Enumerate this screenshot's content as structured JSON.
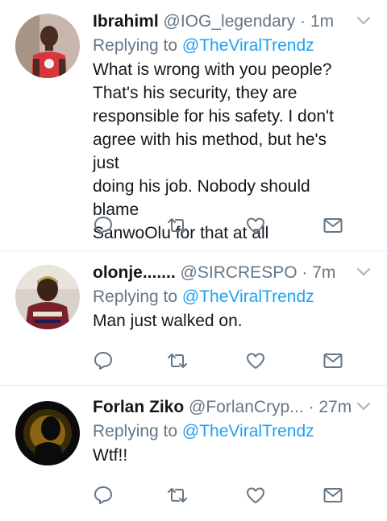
{
  "colors": {
    "link": "#1da1f2",
    "secondary_text": "#657786",
    "primary_text": "#14171a",
    "divider": "#e1e8ed"
  },
  "tweets": [
    {
      "name": "Ibrahiml",
      "handle": "@IOG_legendary",
      "separator": "·",
      "time": "1m",
      "replying_prefix": "Replying to",
      "replying_to": "@TheViralTrendz",
      "text_lines": [
        "What is wrong with you people?",
        "That's his security, they are",
        "responsible for his safety. I don't",
        "agree with his method, but he's just",
        "doing his job. Nobody should blame",
        "SanwoOlu for that at all"
      ],
      "icons": [
        "reply-icon",
        "retweet-icon",
        "like-icon",
        "direct-message-icon"
      ]
    },
    {
      "name": "olonje.......",
      "handle": "@SIRCRESPO",
      "separator": "·",
      "time": "7m",
      "replying_prefix": "Replying to",
      "replying_to": "@TheViralTrendz",
      "text_lines": [
        "Man just walked on."
      ],
      "icons": [
        "reply-icon",
        "retweet-icon",
        "like-icon",
        "direct-message-icon"
      ]
    },
    {
      "name": "Forlan Ziko",
      "handle": "@ForlanCryp...",
      "separator": "·",
      "time": "27m",
      "replying_prefix": "Replying to",
      "replying_to": "@TheViralTrendz",
      "text_lines": [
        "Wtf!!"
      ],
      "icons": [
        "reply-icon",
        "retweet-icon",
        "like-icon",
        "direct-message-icon"
      ]
    }
  ]
}
